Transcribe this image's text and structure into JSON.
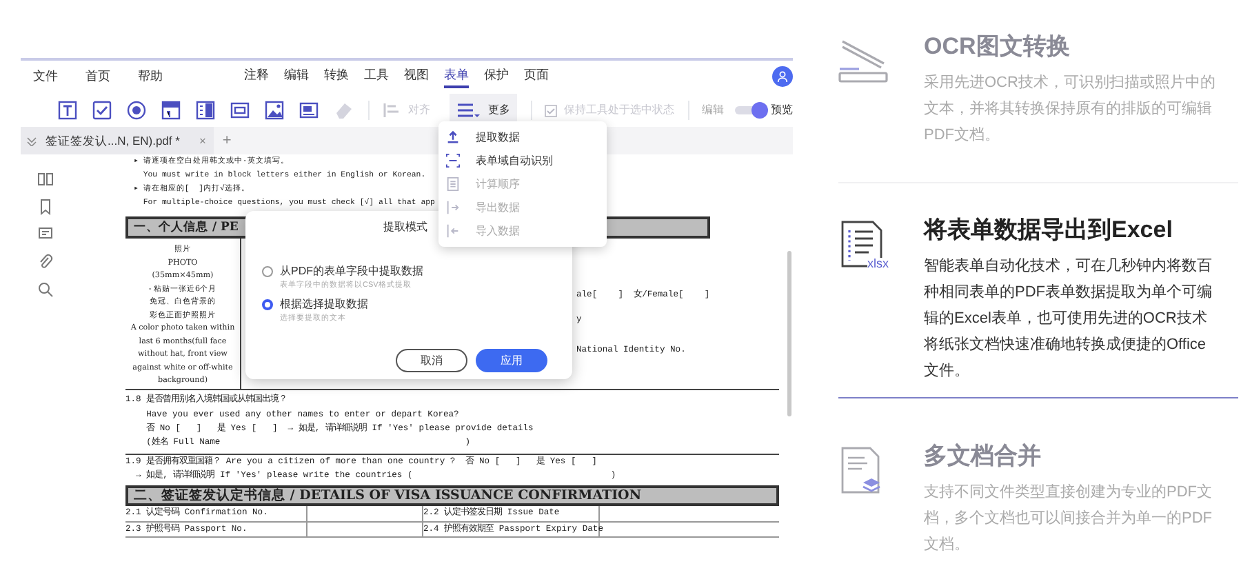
{
  "menu_left": [
    "文件",
    "首页",
    "帮助"
  ],
  "menu_tabs": [
    {
      "label": "注释",
      "selected": false
    },
    {
      "label": "编辑",
      "selected": false
    },
    {
      "label": "转换",
      "selected": false
    },
    {
      "label": "工具",
      "selected": false
    },
    {
      "label": "视图",
      "selected": false
    },
    {
      "label": "表单",
      "selected": true
    },
    {
      "label": "保护",
      "selected": false
    },
    {
      "label": "页面",
      "selected": false
    }
  ],
  "tools": [
    {
      "kind": "textfield",
      "disabled": false
    },
    {
      "kind": "checkbox",
      "disabled": false
    },
    {
      "kind": "radio",
      "disabled": false
    },
    {
      "kind": "combo",
      "disabled": false
    },
    {
      "kind": "list",
      "disabled": false
    },
    {
      "kind": "button",
      "disabled": false
    },
    {
      "kind": "image",
      "disabled": false
    },
    {
      "kind": "signature",
      "disabled": false
    },
    {
      "kind": "eraser",
      "disabled": true
    }
  ],
  "align": {
    "label": "对齐",
    "disabled": true
  },
  "more": {
    "label": "更多",
    "selected": true
  },
  "keep_tool": {
    "label": "保持工具处于选中状态",
    "checked": true,
    "disabled": true
  },
  "mode_toggle": {
    "left": "编辑",
    "right": "预览",
    "on": true
  },
  "doc_tab": {
    "title": "签证签发认...N, EN).pdf *",
    "close": "×",
    "add": "+"
  },
  "document": {
    "intro": [
      "▸ 请逐项在空白处用韩文或中·英文填写。",
      "  You must write in block letters either in English or Korean.",
      "▸ 请在相应的[  ]内打√选择。",
      "  For multiple-choice questions, you must check [√] all that app"
    ],
    "section_1": "一、个人信息 / PE",
    "photo": [
      "照片",
      "PHOTO",
      "(35mm×45mm)",
      "- 粘贴一张近6个月",
      "免冠、白色背景的",
      "彩色正面护照照片",
      "A color photo taken within",
      "last 6 months(full face",
      "without hat, front view",
      "against white or off-white",
      "background)"
    ],
    "right_cells": [
      "ale[    ]  女/Female[    ]",
      "y",
      "National Identity No."
    ],
    "questions": [
      "1.8 是否曾用别名入境韩国或从韩国出境？",
      "    Have you ever used any other names to enter or depart Korea?",
      "    否 No [   ]   是 Yes [   ]  → 如是, 请详细说明 If 'Yes' please provide details",
      "    (姓名 Full Name                                               )",
      "1.9 是否拥有双重国籍？ Are you a citizen of more than one country ?  否 No [   ]   是 Yes [   ]",
      "  → 如是, 请详细说明 If 'Yes' please write the countries (                                      )"
    ],
    "section_2": "二、签证签发认定书信息 / DETAILS OF VISA ISSUANCE CONFIRMATION",
    "table_rows": [
      [
        "2.1 认定号码 Confirmation No.",
        "2.2 认定书签发日期 Issue Date"
      ],
      [
        "2.3 护照号码 Passport No.",
        "2.4 护照有效期至 Passport Expiry Date"
      ]
    ]
  },
  "dropdown": [
    {
      "kind": "extract",
      "label": "提取数据",
      "disabled": false
    },
    {
      "kind": "recognize",
      "label": "表单域自动识别",
      "disabled": false
    },
    {
      "kind": "order",
      "label": "计算顺序",
      "disabled": true
    },
    {
      "kind": "export",
      "label": "导出数据",
      "disabled": true
    },
    {
      "kind": "import",
      "label": "导入数据",
      "disabled": true
    }
  ],
  "dialog": {
    "title": "提取模式",
    "options": [
      {
        "label": "从PDF的表单字段中提取数据",
        "hint": "表单字段中的数据将以CSV格式提取",
        "selected": false
      },
      {
        "label": "根据选择提取数据",
        "hint": "选择要提取的文本",
        "selected": true
      }
    ],
    "cancel": "取消",
    "apply": "应用"
  },
  "features": [
    {
      "kind": "ocr",
      "title": "OCR图文转换",
      "description": "采用先进OCR技术，可识别扫描或照片中的文本，并将其转换保持原有的排版的可编辑PDF文档。",
      "active": false
    },
    {
      "kind": "excel",
      "title": "将表单数据导出到Excel",
      "description": "智能表单自动化技术，可在几秒钟内将数百种相同表单的PDF表单数据提取为单个可编辑的Excel表单，也可使用先进的OCR技术将纸张文档快速准确地转换成便捷的Office文件。",
      "active": true,
      "badge": "xlsx"
    },
    {
      "kind": "merge",
      "title": "多文档合并",
      "description": "支持不同文件类型直接创建为专业的PDF文档，多个文档也可以间接合并为单一的PDF文档。",
      "active": false
    }
  ]
}
